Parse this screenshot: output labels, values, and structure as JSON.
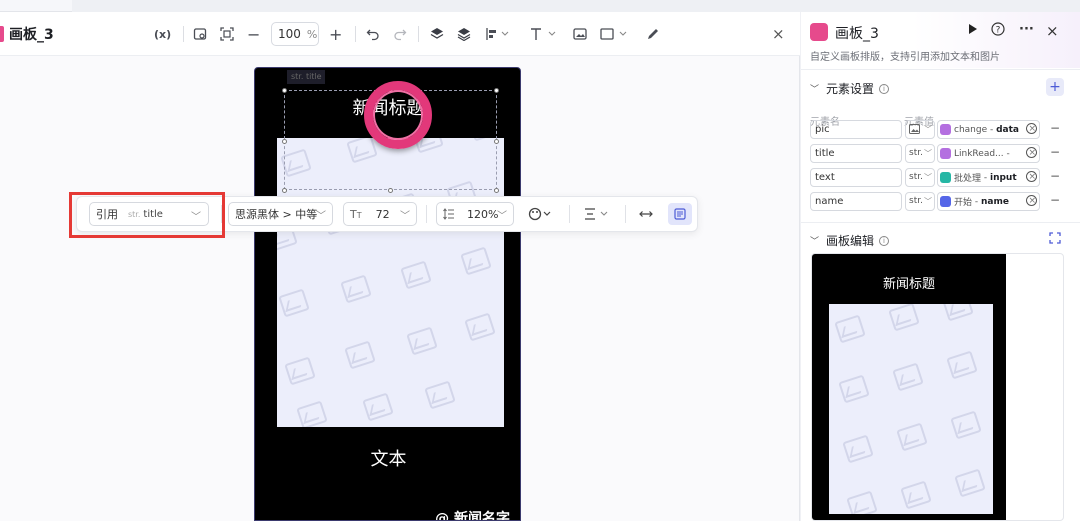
{
  "canvas": {
    "title": "画板_3",
    "zoom": "100",
    "zoom_unit": "%",
    "phone": {
      "title": "新闻标题",
      "text": "文本",
      "name": "@ 新闻名字",
      "str_tag": "str. title"
    }
  },
  "toolbar_icons": [
    "variable-icon",
    "frame-icon",
    "fit-icon",
    "zoom-out-icon",
    "zoom-in-icon",
    "undo-icon",
    "redo-icon",
    "layer-up-icon",
    "layers-icon",
    "align-icon",
    "text-icon",
    "image-icon",
    "shape-icon",
    "pen-icon",
    "close-icon"
  ],
  "toolbar": {
    "var_label": "(x)",
    "close": "×"
  },
  "float_toolbar": {
    "ref_label": "引用",
    "ref_type": "str.",
    "ref_value": "title",
    "font": "思源黑体 > 中等",
    "font_size": "72",
    "line_height": "120%"
  },
  "panel": {
    "title": "画板_3",
    "desc": "自定义画板排版，支持引用添加文本和图片",
    "elements_title": "元素设置",
    "col_name": "元素名",
    "col_value": "元素值",
    "rows": [
      {
        "name": "pic",
        "type": "",
        "source": "change",
        "field": "data",
        "color": "#b46fe0"
      },
      {
        "name": "title",
        "type": "str.",
        "source": "LinkRead...",
        "field": "",
        "color": "#b46fe0"
      },
      {
        "name": "text",
        "type": "str.",
        "source": "批处理",
        "field": "input",
        "color": "#25b7a5"
      },
      {
        "name": "name",
        "type": "str.",
        "source": "开始",
        "field": "name",
        "color": "#5566e8"
      }
    ],
    "board_title": "画板编辑",
    "preview_title": "新闻标题"
  },
  "colors": {
    "brand": "#e64a8c",
    "accent": "#4d5bd6",
    "highlight": "#e53935"
  }
}
